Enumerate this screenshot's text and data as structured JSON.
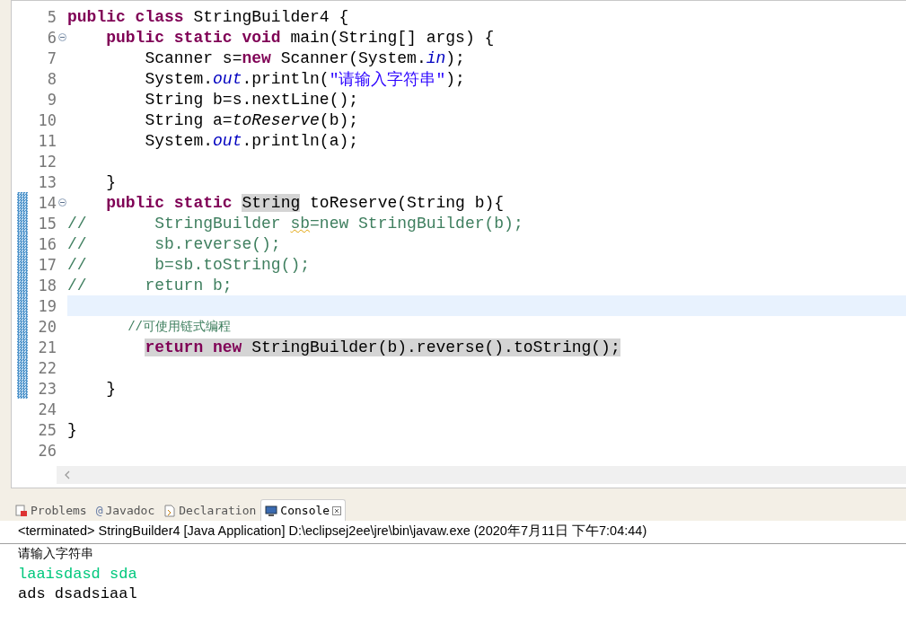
{
  "editor": {
    "lines": [
      {
        "number": "5",
        "fold": false,
        "changed": false,
        "current": false,
        "tokens": [
          {
            "text": "public class ",
            "kind": "keyword"
          },
          {
            "text": "StringBuilder4 {",
            "kind": "plain"
          }
        ]
      },
      {
        "number": "6",
        "fold": true,
        "changed": false,
        "current": false,
        "tokens": [
          {
            "text": "    public static void ",
            "kind": "keyword"
          },
          {
            "text": "main(String[] args) {",
            "kind": "plain"
          }
        ]
      },
      {
        "number": "7",
        "fold": false,
        "changed": false,
        "current": false,
        "tokens": [
          {
            "text": "        Scanner s=",
            "kind": "plain"
          },
          {
            "text": "new ",
            "kind": "keyword"
          },
          {
            "text": "Scanner(System.",
            "kind": "plain"
          },
          {
            "text": "in",
            "kind": "field"
          },
          {
            "text": ");",
            "kind": "plain"
          }
        ]
      },
      {
        "number": "8",
        "fold": false,
        "changed": false,
        "current": false,
        "tokens": [
          {
            "text": "        System.",
            "kind": "plain"
          },
          {
            "text": "out",
            "kind": "field"
          },
          {
            "text": ".println(",
            "kind": "plain"
          },
          {
            "text": "\"请输入字符串\"",
            "kind": "string"
          },
          {
            "text": ");",
            "kind": "plain"
          }
        ]
      },
      {
        "number": "9",
        "fold": false,
        "changed": false,
        "current": false,
        "tokens": [
          {
            "text": "        String b=s.nextLine();",
            "kind": "plain"
          }
        ]
      },
      {
        "number": "10",
        "fold": false,
        "changed": false,
        "current": false,
        "tokens": [
          {
            "text": "        String a=",
            "kind": "plain"
          },
          {
            "text": "toReserve",
            "kind": "static"
          },
          {
            "text": "(b);",
            "kind": "plain"
          }
        ]
      },
      {
        "number": "11",
        "fold": false,
        "changed": false,
        "current": false,
        "tokens": [
          {
            "text": "        System.",
            "kind": "plain"
          },
          {
            "text": "out",
            "kind": "field"
          },
          {
            "text": ".println(a);",
            "kind": "plain"
          }
        ]
      },
      {
        "number": "12",
        "fold": false,
        "changed": false,
        "current": false
      },
      {
        "number": "13",
        "fold": false,
        "changed": false,
        "current": false,
        "tokens": [
          {
            "text": "    }",
            "kind": "plain"
          }
        ]
      },
      {
        "number": "14",
        "fold": true,
        "changed": true,
        "current": false,
        "tokens": [
          {
            "text": "    public static ",
            "kind": "keyword"
          },
          {
            "text": "String",
            "kind": "plain",
            "marked": true
          },
          {
            "text": " toReserve(String b){",
            "kind": "plain"
          }
        ]
      },
      {
        "number": "15",
        "fold": false,
        "changed": true,
        "current": false,
        "tokens": [
          {
            "text": "//       StringBuilder ",
            "kind": "comment"
          },
          {
            "text": "sb",
            "kind": "comment",
            "warning": true
          },
          {
            "text": "=new StringBuilder(b);",
            "kind": "comment"
          }
        ]
      },
      {
        "number": "16",
        "fold": false,
        "changed": true,
        "current": false,
        "tokens": [
          {
            "text": "//       sb.reverse();",
            "kind": "comment"
          }
        ]
      },
      {
        "number": "17",
        "fold": false,
        "changed": true,
        "current": false,
        "tokens": [
          {
            "text": "//       b=sb.toString();",
            "kind": "comment"
          }
        ]
      },
      {
        "number": "18",
        "fold": false,
        "changed": true,
        "current": false,
        "tokens": [
          {
            "text": "//      return b;",
            "kind": "comment"
          }
        ]
      },
      {
        "number": "19",
        "fold": false,
        "changed": true,
        "current": true
      },
      {
        "number": "20",
        "fold": false,
        "changed": true,
        "current": false,
        "tokens": [
          {
            "text": "        //可使用链式编程",
            "kind": "comment-cjk"
          }
        ]
      },
      {
        "number": "21",
        "fold": false,
        "changed": true,
        "current": false,
        "tokens": [
          {
            "text": "return new ",
            "kind": "keyword",
            "marked": true,
            "indent": true
          },
          {
            "text": "StringBuilder(b).reverse().toString();",
            "kind": "plain",
            "marked": true
          }
        ]
      },
      {
        "number": "22",
        "fold": false,
        "changed": true,
        "current": false
      },
      {
        "number": "23",
        "fold": false,
        "changed": true,
        "current": false,
        "tokens": [
          {
            "text": "    }",
            "kind": "plain"
          }
        ]
      },
      {
        "number": "24",
        "fold": false,
        "changed": false,
        "current": false
      },
      {
        "number": "25",
        "fold": false,
        "changed": false,
        "current": false,
        "tokens": [
          {
            "text": "}",
            "kind": "plain"
          }
        ]
      },
      {
        "number": "26",
        "fold": false,
        "changed": false,
        "current": false
      }
    ]
  },
  "panel": {
    "tabs": [
      {
        "label": "Problems",
        "kind": "problems",
        "selected": false
      },
      {
        "label": "Javadoc",
        "kind": "javadoc",
        "icon_text": "@",
        "selected": false
      },
      {
        "label": "Declaration",
        "kind": "declaration",
        "selected": false
      },
      {
        "label": "Console",
        "kind": "console",
        "selected": true
      }
    ],
    "console_header": "<terminated> StringBuilder4 [Java Application] D:\\eclipsej2ee\\jre\\bin\\javaw.exe (2020年7月11日 下午7:04:44)",
    "output": [
      {
        "text": "请输入字符串",
        "kind": "prompt"
      },
      {
        "text": "laaisdasd sda",
        "kind": "input"
      },
      {
        "text": "ads dsadsiaal",
        "kind": "output"
      }
    ]
  }
}
